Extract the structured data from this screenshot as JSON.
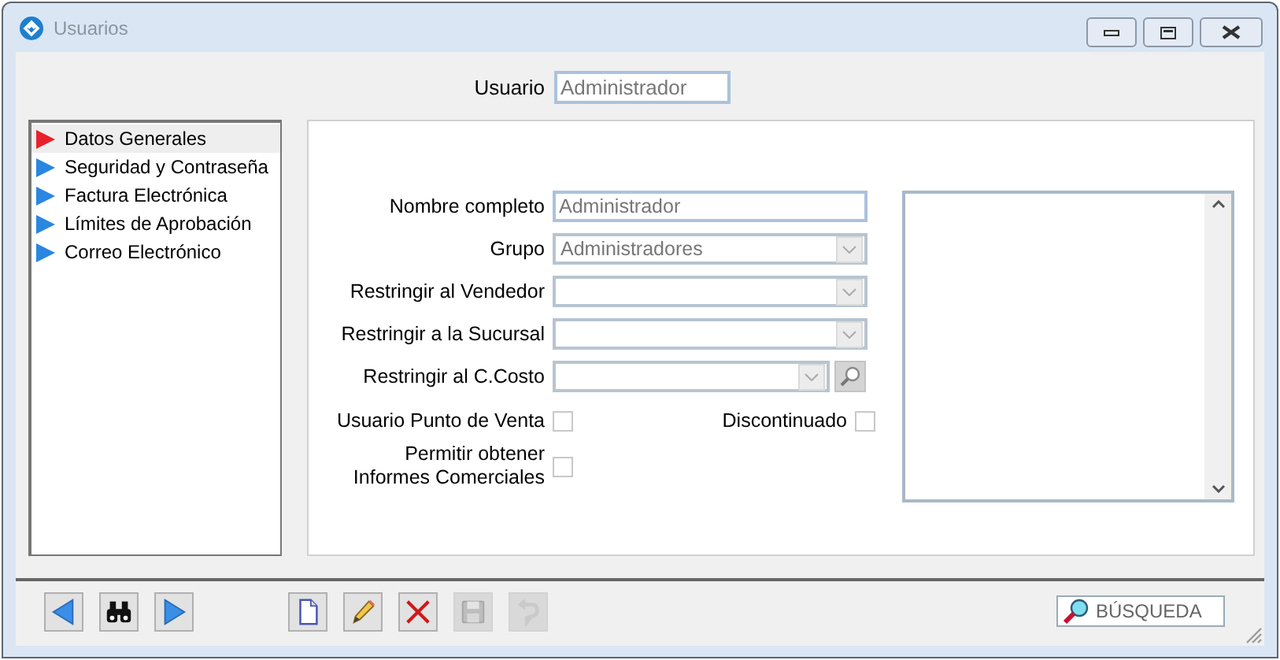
{
  "window": {
    "title": "Usuarios"
  },
  "usuario": {
    "label": "Usuario",
    "value": "Administrador"
  },
  "sidebar": {
    "items": [
      {
        "label": "Datos Generales",
        "selected": true
      },
      {
        "label": "Seguridad y Contraseña",
        "selected": false
      },
      {
        "label": "Factura Electrónica",
        "selected": false
      },
      {
        "label": "Límites de Aprobación",
        "selected": false
      },
      {
        "label": "Correo Electrónico",
        "selected": false
      }
    ]
  },
  "form": {
    "fields": [
      {
        "kind": "text",
        "label": "Nombre completo",
        "value": "Administrador"
      },
      {
        "kind": "select",
        "label": "Grupo",
        "value": "Administradores"
      },
      {
        "kind": "select",
        "label": "Restringir al Vendedor"
      },
      {
        "kind": "select",
        "label": "Restringir a la Sucursal"
      },
      {
        "kind": "lookup",
        "label": "Restringir al C.Costo"
      }
    ],
    "checkboxes": [
      {
        "label": "Usuario Punto de Venta",
        "checked": false
      },
      {
        "label": "Discontinuado",
        "checked": false
      },
      {
        "label": "Permitir obtener Informes Comerciales",
        "checked": false
      }
    ]
  },
  "toolbar": {
    "buttons": [
      {
        "kind": "previous",
        "disabled": false
      },
      {
        "kind": "find",
        "disabled": false
      },
      {
        "kind": "next",
        "disabled": false
      },
      {
        "kind": "new",
        "disabled": false
      },
      {
        "kind": "edit",
        "disabled": false
      },
      {
        "kind": "delete",
        "disabled": false
      },
      {
        "kind": "save",
        "disabled": true
      },
      {
        "kind": "undo",
        "disabled": true
      }
    ]
  },
  "search": {
    "placeholder": "BÚSQUEDA"
  }
}
